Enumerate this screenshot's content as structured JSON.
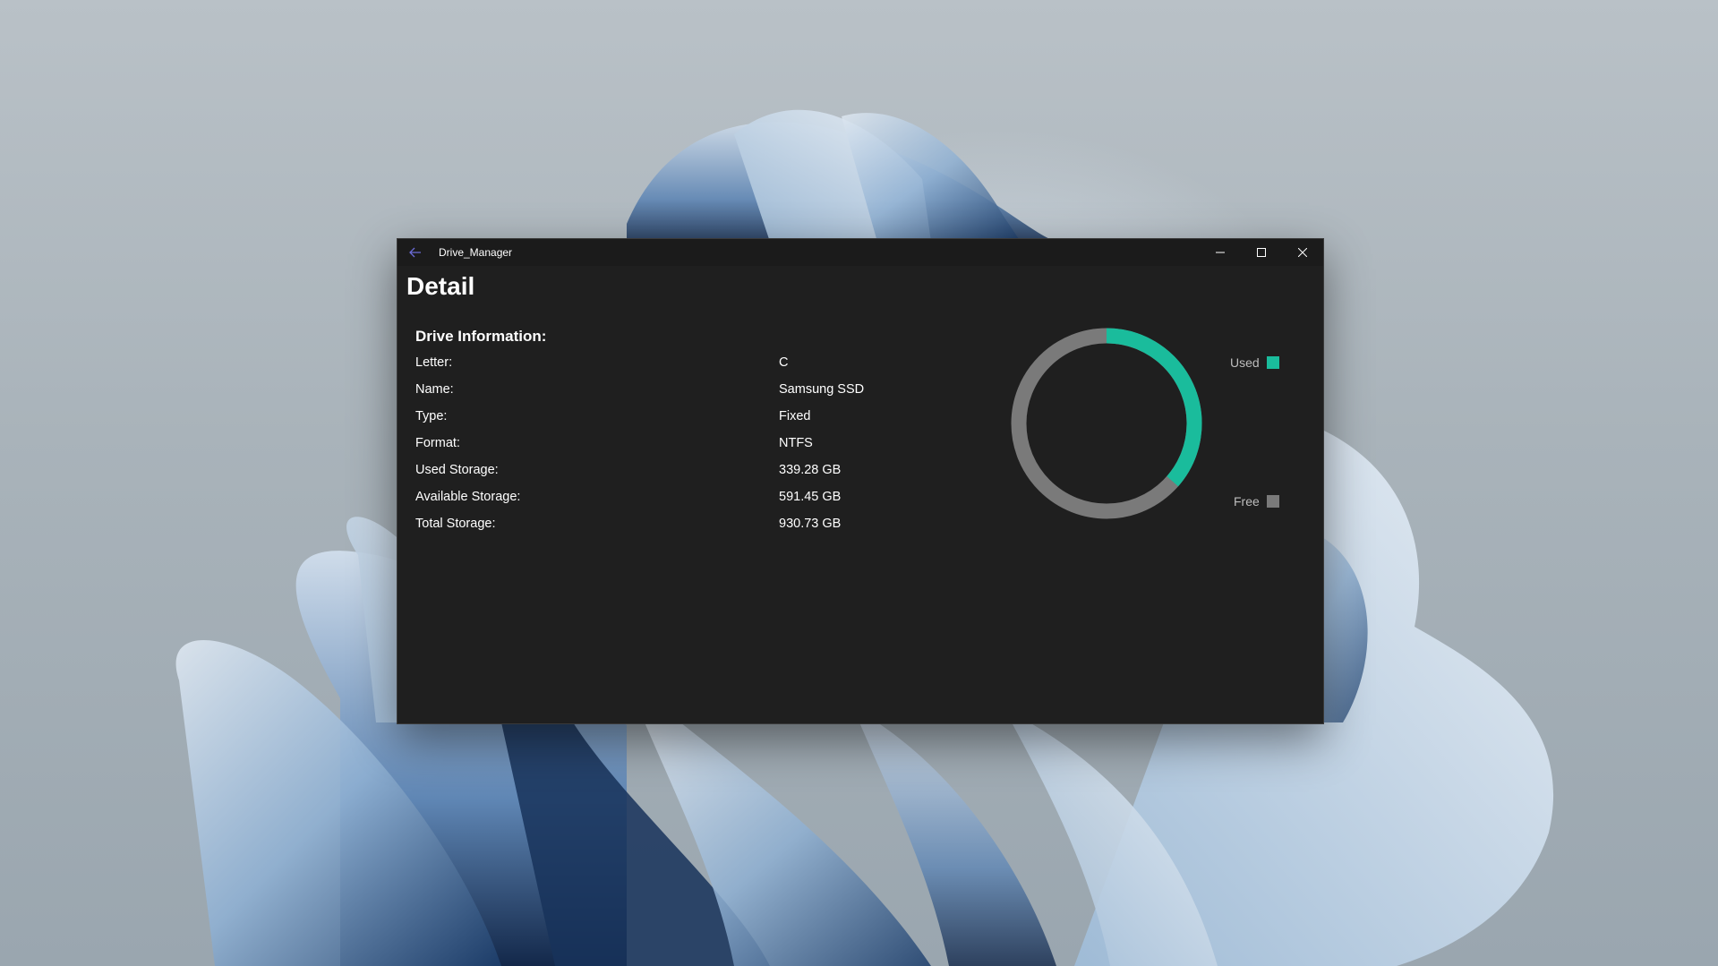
{
  "window": {
    "title": "Drive_Manager"
  },
  "page": {
    "title": "Detail",
    "section_title": "Drive Information:"
  },
  "drive_info": [
    {
      "label": "Letter:",
      "value": "C"
    },
    {
      "label": "Name:",
      "value": "Samsung SSD"
    },
    {
      "label": "Type:",
      "value": "Fixed"
    },
    {
      "label": "Format:",
      "value": "NTFS"
    },
    {
      "label": "Used Storage:",
      "value": "339.28 GB"
    },
    {
      "label": "Available Storage:",
      "value": "591.45 GB"
    },
    {
      "label": "Total Storage:",
      "value": "930.73 GB"
    }
  ],
  "chart_data": {
    "type": "pie",
    "categories": [
      "Used",
      "Free"
    ],
    "values": [
      339.28,
      591.45
    ],
    "colors": [
      "#1abc9c",
      "#7a7a7a"
    ],
    "legend": "right"
  },
  "colors": {
    "accent": "#1abc9c",
    "free": "#7a7a7a",
    "window_bg": "#1f1f1f",
    "back_arrow": "#6b6bd6"
  },
  "icons": {
    "back": "back-arrow-icon",
    "minimize": "minimize-icon",
    "maximize": "maximize-icon",
    "close": "close-icon"
  }
}
